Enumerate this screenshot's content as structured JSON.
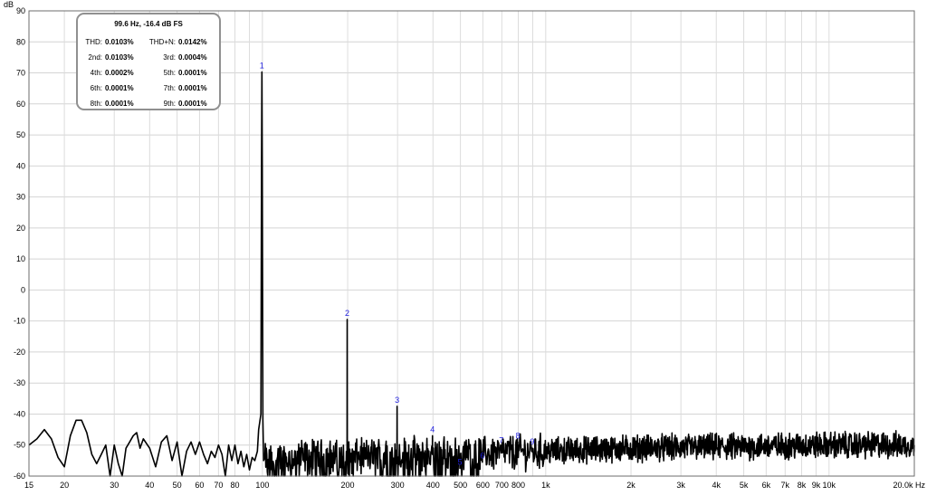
{
  "chart_data": {
    "type": "line",
    "xscale": "log",
    "xlim": [
      15,
      20000
    ],
    "ylim": [
      -60,
      90
    ],
    "ylabel": "dB",
    "xunit": "Hz",
    "grid": true,
    "x_ticks": [
      {
        "value": 15,
        "label": "15"
      },
      {
        "value": 20,
        "label": "20"
      },
      {
        "value": 30,
        "label": "30"
      },
      {
        "value": 40,
        "label": "40"
      },
      {
        "value": 50,
        "label": "50"
      },
      {
        "value": 60,
        "label": "60"
      },
      {
        "value": 70,
        "label": "70"
      },
      {
        "value": 80,
        "label": "80"
      },
      {
        "value": 100,
        "label": "100"
      },
      {
        "value": 200,
        "label": "200"
      },
      {
        "value": 300,
        "label": "300"
      },
      {
        "value": 400,
        "label": "400"
      },
      {
        "value": 500,
        "label": "500"
      },
      {
        "value": 600,
        "label": "600"
      },
      {
        "value": 700,
        "label": "700"
      },
      {
        "value": 800,
        "label": "800"
      },
      {
        "value": 1000,
        "label": "1k"
      },
      {
        "value": 2000,
        "label": "2k"
      },
      {
        "value": 3000,
        "label": "3k"
      },
      {
        "value": 4000,
        "label": "4k"
      },
      {
        "value": 5000,
        "label": "5k"
      },
      {
        "value": 6000,
        "label": "6k"
      },
      {
        "value": 7000,
        "label": "7k"
      },
      {
        "value": 8000,
        "label": "8k"
      },
      {
        "value": 9000,
        "label": "9k"
      },
      {
        "value": 10000,
        "label": "10k"
      },
      {
        "value": 20000,
        "label": "20.0k Hz"
      }
    ],
    "y_ticks": [
      90,
      80,
      70,
      60,
      50,
      40,
      30,
      20,
      10,
      0,
      -10,
      -20,
      -30,
      -40,
      -50,
      -60
    ],
    "series": [
      {
        "color": "#000000",
        "low_freq": [
          [
            15,
            -50
          ],
          [
            16,
            -48
          ],
          [
            17,
            -45
          ],
          [
            18,
            -48
          ],
          [
            19,
            -54
          ],
          [
            20,
            -57
          ],
          [
            21,
            -47
          ],
          [
            22,
            -42
          ],
          [
            23,
            -42
          ],
          [
            24,
            -46
          ],
          [
            25,
            -53
          ],
          [
            26,
            -56
          ],
          [
            27,
            -53
          ],
          [
            28,
            -50
          ],
          [
            29,
            -60
          ],
          [
            30,
            -50
          ],
          [
            31,
            -56
          ],
          [
            32,
            -60
          ],
          [
            33,
            -51
          ],
          [
            34,
            -49
          ],
          [
            35,
            -47
          ],
          [
            36,
            -46
          ],
          [
            37,
            -51
          ],
          [
            38,
            -48
          ],
          [
            40,
            -51
          ],
          [
            42,
            -57
          ],
          [
            44,
            -49
          ],
          [
            46,
            -47
          ],
          [
            48,
            -55
          ],
          [
            50,
            -49
          ],
          [
            52,
            -60
          ],
          [
            54,
            -52
          ],
          [
            56,
            -49
          ],
          [
            58,
            -53
          ],
          [
            60,
            -49
          ],
          [
            62,
            -53
          ],
          [
            64,
            -56
          ],
          [
            66,
            -52
          ],
          [
            68,
            -54
          ],
          [
            70,
            -50
          ],
          [
            72,
            -53
          ],
          [
            74,
            -60
          ],
          [
            76,
            -50
          ],
          [
            78,
            -55
          ],
          [
            80,
            -50
          ],
          [
            82,
            -56
          ],
          [
            84,
            -52
          ],
          [
            86,
            -57
          ],
          [
            88,
            -53
          ],
          [
            90,
            -58
          ],
          [
            92,
            -54
          ],
          [
            94,
            -55
          ],
          [
            96,
            -52
          ],
          [
            97,
            -45
          ]
        ],
        "noise_floor": [
          [
            105,
            -55
          ],
          [
            150,
            -54
          ],
          [
            200,
            -54
          ],
          [
            300,
            -53
          ],
          [
            500,
            -53
          ],
          [
            1000,
            -52
          ],
          [
            2000,
            -51
          ],
          [
            5000,
            -50.5
          ],
          [
            10000,
            -50
          ],
          [
            20000,
            -50
          ]
        ]
      }
    ],
    "peaks": [
      {
        "label": "1",
        "freq": 99.6,
        "db": 70.3
      },
      {
        "label": "2",
        "freq": 199.2,
        "db": -9.5
      },
      {
        "label": "3",
        "freq": 298.8,
        "db": -37.5
      },
      {
        "label": "4",
        "freq": 398.4,
        "db": -47.0
      },
      {
        "label": "5",
        "freq": 498.0,
        "db": -57.5
      },
      {
        "label": "6",
        "freq": 597.6,
        "db": -55.5
      },
      {
        "label": "7",
        "freq": 697.2,
        "db": -50.5
      },
      {
        "label": "8",
        "freq": 796.8,
        "db": -49.0
      },
      {
        "label": "9",
        "freq": 896.4,
        "db": -51.0
      }
    ]
  },
  "legend": {
    "title": "99.6 Hz, -16.4 dB FS",
    "rows": [
      {
        "l_label": "THD:",
        "l_value": "0.0103%",
        "r_label": "THD+N:",
        "r_value": "0.0142%"
      },
      {
        "l_label": "2nd:",
        "l_value": "0.0103%",
        "r_label": "3rd:",
        "r_value": "0.0004%"
      },
      {
        "l_label": "4th:",
        "l_value": "0.0002%",
        "r_label": "5th:",
        "r_value": "0.0001%"
      },
      {
        "l_label": "6th:",
        "l_value": "0.0001%",
        "r_label": "7th:",
        "r_value": "0.0001%"
      },
      {
        "l_label": "8th:",
        "l_value": "0.0001%",
        "r_label": "9th:",
        "r_value": "0.0001%"
      }
    ]
  }
}
